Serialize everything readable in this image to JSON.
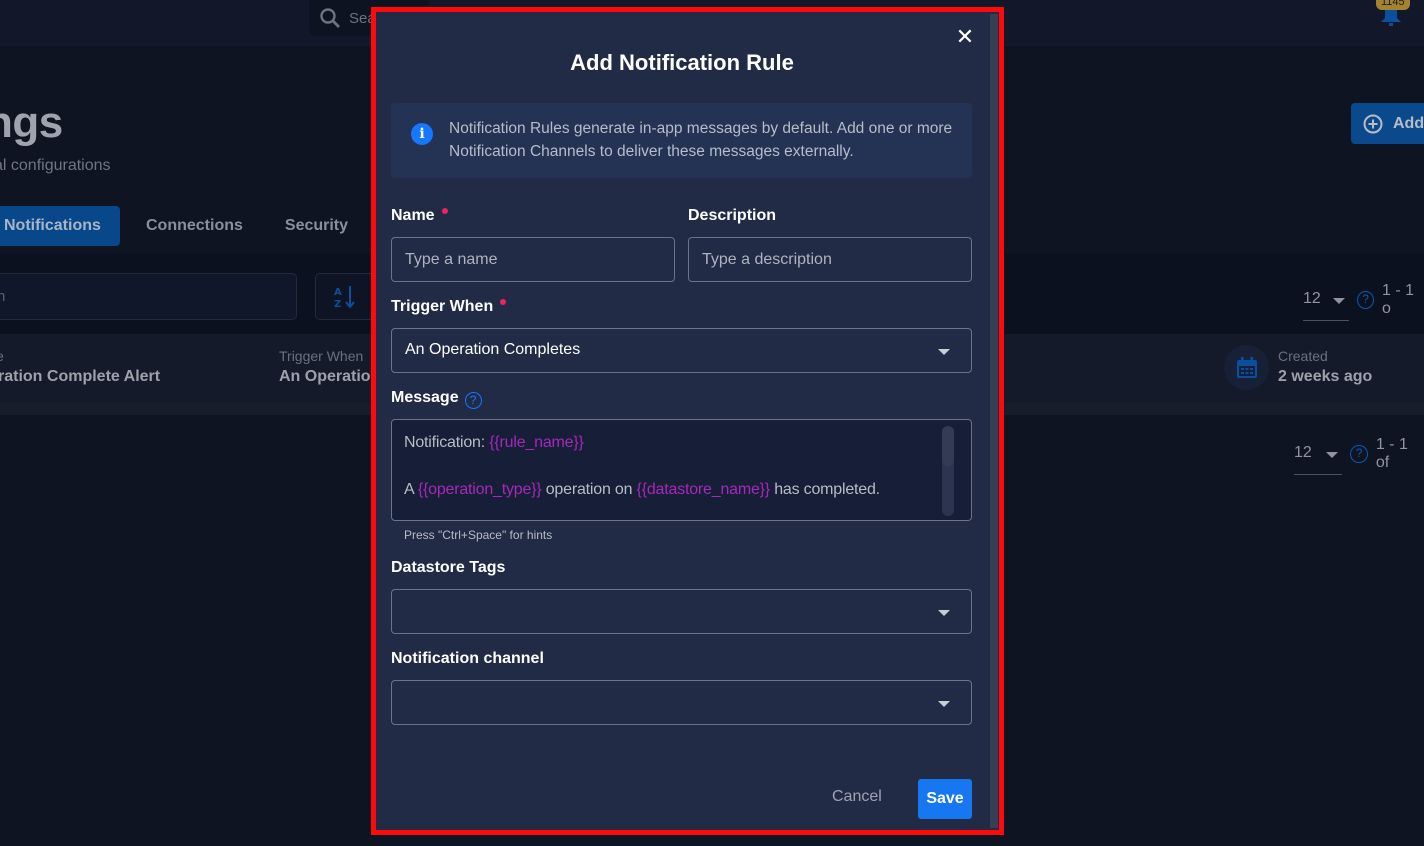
{
  "background": {
    "top_search_placeholder": "Sea",
    "notification_badge": "1145",
    "page_title": "ngs",
    "page_subtitle": "al configurations",
    "add_button_label": "Add",
    "tabs": [
      {
        "label": "Notifications",
        "active": true
      },
      {
        "label": "Connections",
        "active": false
      },
      {
        "label": "Security",
        "active": false
      }
    ],
    "list_search_placeholder": "h",
    "pager_top": {
      "page_size": "12",
      "range": "1 - 1 o"
    },
    "pager_bottom": {
      "page_size": "12",
      "range": "1 - 1 of"
    },
    "rule_card": {
      "name_label": "e",
      "name_value": "ration Complete Alert",
      "trigger_label": "Trigger When",
      "trigger_value": "An Operation",
      "created_label": "Created",
      "created_value": "2 weeks ago"
    }
  },
  "modal": {
    "title": "Add Notification Rule",
    "close_icon": "close-icon",
    "info_text": "Notification Rules generate in-app messages by default. Add one or more Notification Channels to deliver these messages externally.",
    "name": {
      "label": "Name",
      "placeholder": "Type a name",
      "value": "",
      "required": true
    },
    "description": {
      "label": "Description",
      "placeholder": "Type a description",
      "value": ""
    },
    "trigger": {
      "label": "Trigger When",
      "value": "An Operation Completes",
      "required": true
    },
    "message": {
      "label": "Message",
      "line1_text": "Notification: ",
      "line1_var": "{{rule_name}}",
      "line2_a": "A ",
      "line2_var1": "{{operation_type}}",
      "line2_b": " operation on ",
      "line2_var2": "{{datastore_name}}",
      "line2_c": " has completed.",
      "hint": "Press \"Ctrl+Space\" for hints"
    },
    "datastore_tags": {
      "label": "Datastore Tags",
      "value": ""
    },
    "notification_channel": {
      "label": "Notification channel",
      "value": ""
    },
    "cancel_label": "Cancel",
    "save_label": "Save"
  },
  "colors": {
    "accent": "#1677f0",
    "required_dot": "#f0235a",
    "template_variable": "#a729b8",
    "highlight_border": "#ff0a0a",
    "modal_bg": "#222b45"
  }
}
